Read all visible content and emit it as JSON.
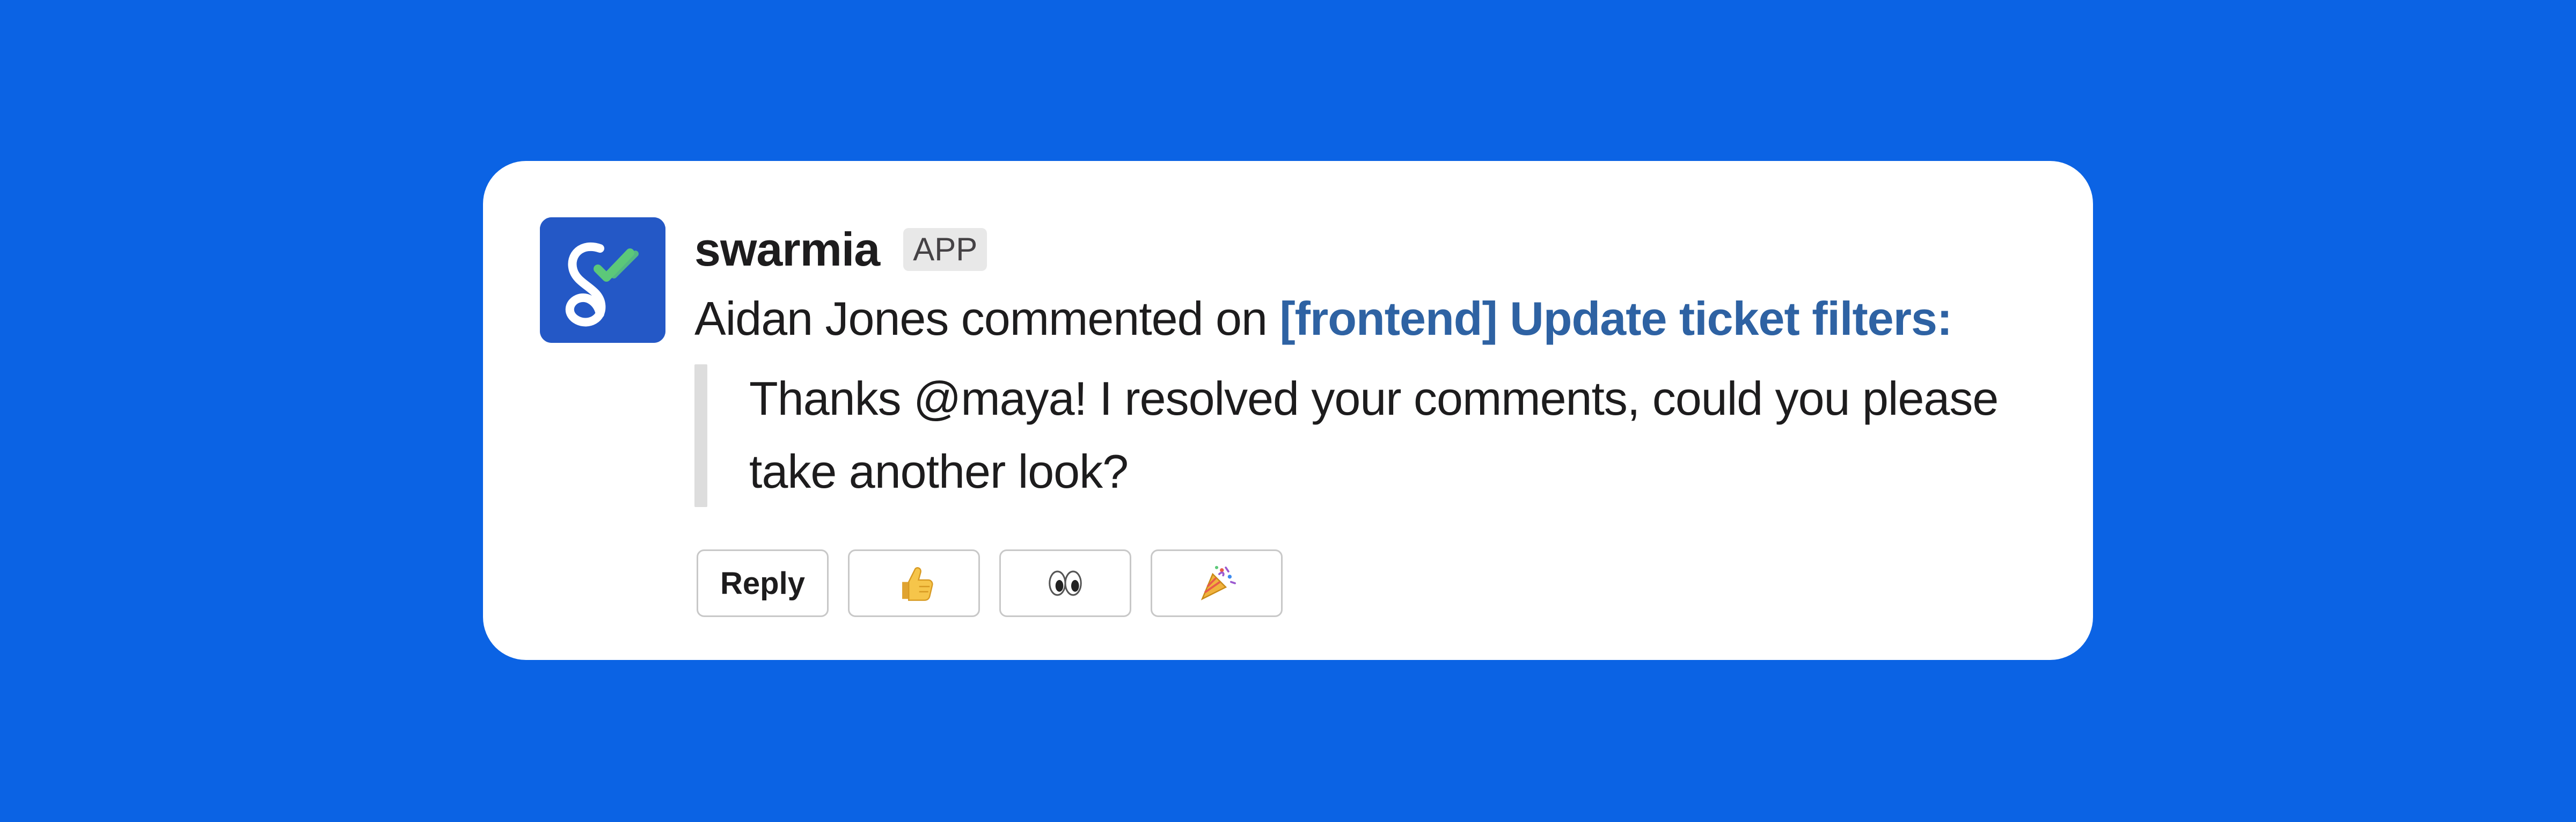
{
  "notification": {
    "app_name": "swarmia",
    "app_badge": "APP",
    "message_prefix": "Aidan Jones commented on",
    "message_link": "[frontend] Update ticket filters:",
    "quote_line_1": "Thanks @maya! I resolved your comments, could you please",
    "quote_line_2": "take another look?"
  },
  "actions": {
    "reply_label": "Reply",
    "reactions": [
      "thumbs-up-icon",
      "eyes-icon",
      "party-popper-icon"
    ]
  },
  "colors": {
    "background": "#0b63e4",
    "card": "#ffffff",
    "avatar": "#2458c6",
    "link": "#2e62a3",
    "check_green": "#5cc879"
  }
}
